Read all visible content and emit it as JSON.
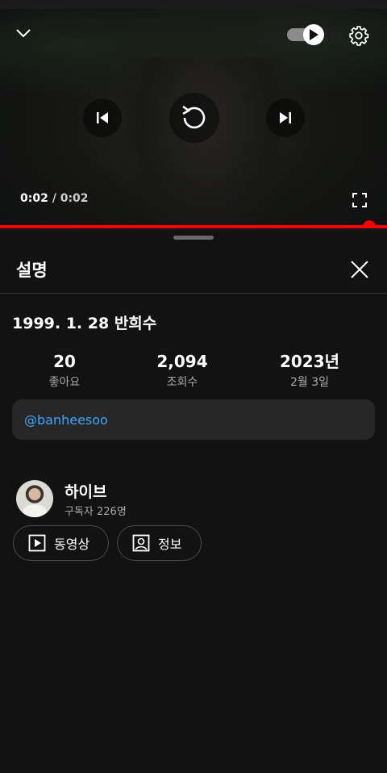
{
  "player": {
    "current_time": "0:02",
    "separator": "/",
    "duration": "0:02",
    "progress": 1.0,
    "autoplay_on": true,
    "progress_color": "#ff0000"
  },
  "description": {
    "title": "설명",
    "video_title": "1999. 1. 28 반희수",
    "stats": [
      {
        "value": "20",
        "label": "좋아요"
      },
      {
        "value": "2,094",
        "label": "조회수"
      },
      {
        "value": "2023년",
        "label": "2월 3일"
      }
    ],
    "hashtag": "@banheesoo",
    "hashtag_color": "#3ea6ff"
  },
  "channel": {
    "name": "하이브",
    "subscribers": "구독자 226명",
    "buttons": [
      {
        "label": "동영상",
        "icon": "play-square-icon"
      },
      {
        "label": "정보",
        "icon": "person-square-icon"
      }
    ]
  }
}
